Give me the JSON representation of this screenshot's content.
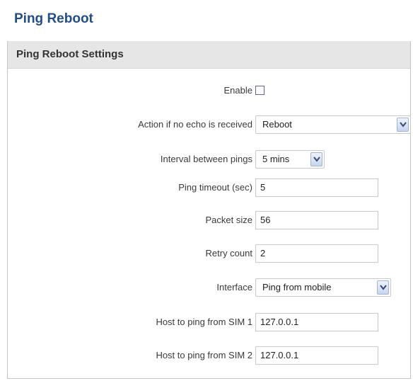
{
  "page": {
    "title": "Ping Reboot"
  },
  "section": {
    "title": "Ping Reboot Settings"
  },
  "fields": {
    "enable": {
      "label": "Enable",
      "checked": false
    },
    "action": {
      "label": "Action if no echo is received",
      "value": "Reboot"
    },
    "interval": {
      "label": "Interval between pings",
      "value": "5 mins"
    },
    "timeout": {
      "label": "Ping timeout (sec)",
      "value": "5"
    },
    "packet_size": {
      "label": "Packet size",
      "value": "56"
    },
    "retry": {
      "label": "Retry count",
      "value": "2"
    },
    "interface": {
      "label": "Interface",
      "value": "Ping from mobile"
    },
    "host_sim1": {
      "label": "Host to ping from SIM 1",
      "value": "127.0.0.1"
    },
    "host_sim2": {
      "label": "Host to ping from SIM 2",
      "value": "127.0.0.1"
    }
  },
  "icons": {
    "dropdown": "chevron-down-icon"
  },
  "colors": {
    "title": "#1f4e8c",
    "header_bg": "#e6e6e6"
  }
}
